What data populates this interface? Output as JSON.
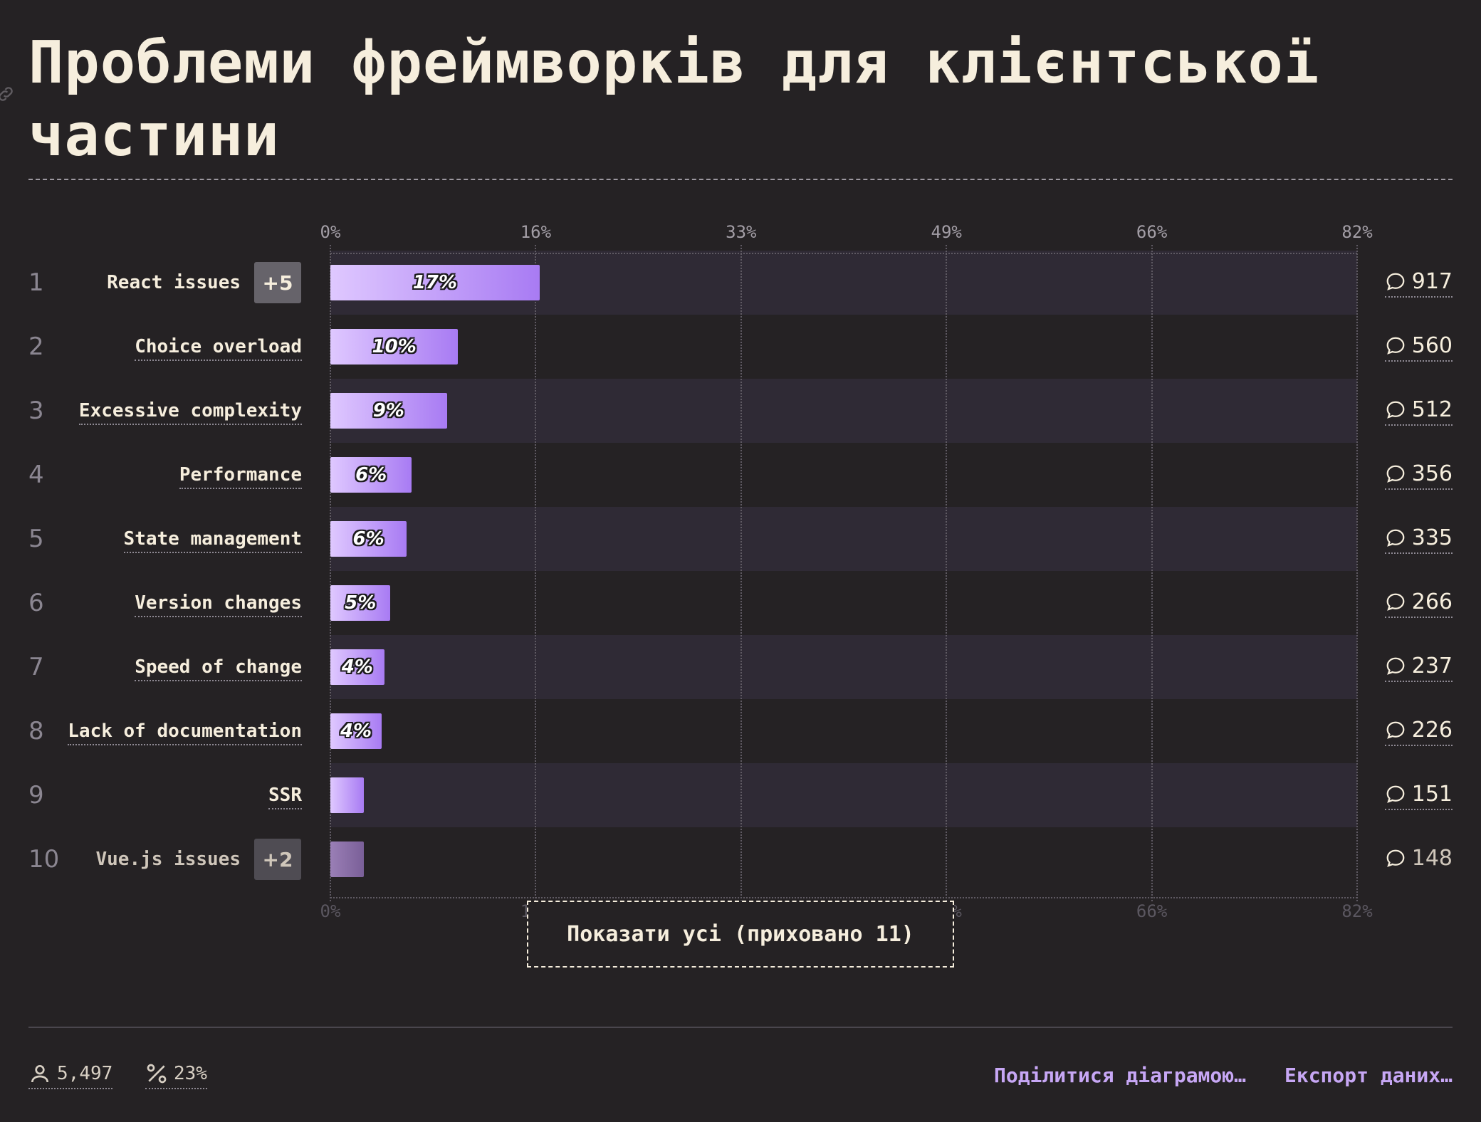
{
  "title": "Проблеми фреймворків для клієнтської частини",
  "chart_data": {
    "type": "bar",
    "orientation": "horizontal",
    "title": "Проблеми фреймворків для клієнтської частини",
    "xlim": [
      0,
      82
    ],
    "x_ticks": [
      "0%",
      "16%",
      "33%",
      "49%",
      "66%",
      "82%"
    ],
    "x_tick_values": [
      0,
      16.4,
      32.8,
      49.2,
      65.6,
      82
    ],
    "grid": true,
    "categories": [
      "React issues",
      "Choice overload",
      "Excessive complexity",
      "Performance",
      "State management",
      "Version changes",
      "Speed of change",
      "Lack of documentation",
      "SSR",
      "Vue.js issues"
    ],
    "ranks": [
      "1",
      "2",
      "3",
      "4",
      "5",
      "6",
      "7",
      "8",
      "9",
      "10"
    ],
    "values": [
      16.7,
      10.2,
      9.3,
      6.5,
      6.1,
      4.8,
      4.3,
      4.1,
      2.7,
      2.7
    ],
    "value_labels": [
      "17%",
      "10%",
      "9%",
      "6%",
      "6%",
      "5%",
      "4%",
      "4%",
      "",
      ""
    ],
    "counts": [
      "917",
      "560",
      "512",
      "356",
      "335",
      "266",
      "237",
      "226",
      "151",
      "148"
    ],
    "extra_badges": {
      "0": "+5",
      "9": "+2"
    }
  },
  "show_all_label": "Показати усі (приховано 11)",
  "footer": {
    "respondents": "5,497",
    "percentage": "23%",
    "share_label": "Поділитися діаграмою…",
    "export_label": "Експорт даних…"
  },
  "colors": {
    "background": "#252224",
    "text": "#f6eedd",
    "bar_start": "#dfc8ff",
    "bar_end": "#a87bf3",
    "accent_link": "#c7a7f5",
    "row_stripe": "#2f2a35"
  },
  "icons": {
    "comment": "speech-bubble-icon",
    "respondents": "user-icon",
    "percentage": "percent-icon",
    "link": "link-icon"
  }
}
